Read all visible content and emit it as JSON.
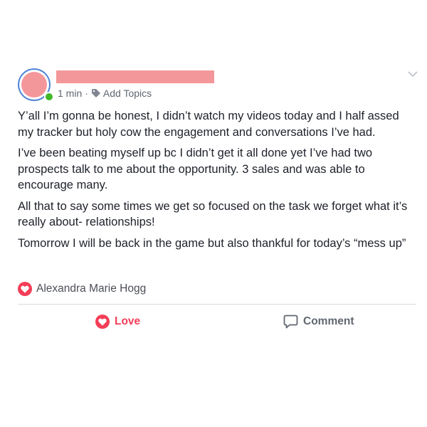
{
  "post": {
    "time": "1 min",
    "separator": "·",
    "add_topics_label": "Add Topics",
    "paragraphs": [
      "Y’all I’m gonna be honest, I didn’t watch my videos today and I half assed my tracker but holy cow the engagement and conversations I’ve had.",
      "I’ve been beating myself up bc I didn’t get it all done yet I’ve had two prospects talk to me about the opportunity. 3 sales and was able to encourage many.",
      "All that to say some times we get so focused on the task we forget what it’s really about- relationships!",
      "Tomorrow I will be back in the game but also thankful for today’s “mess up”"
    ]
  },
  "reactions": {
    "icon": "love-icon",
    "reactor_name": "Alexandra Marie Hogg"
  },
  "actions": {
    "love_label": "Love",
    "comment_label": "Comment"
  },
  "colors": {
    "love": "#f33e58",
    "avatar_ring": "#4f86d6",
    "avatar_fill": "#f4979a",
    "online": "#42b72a",
    "meta_text": "#606770",
    "body_text": "#1d2129"
  }
}
